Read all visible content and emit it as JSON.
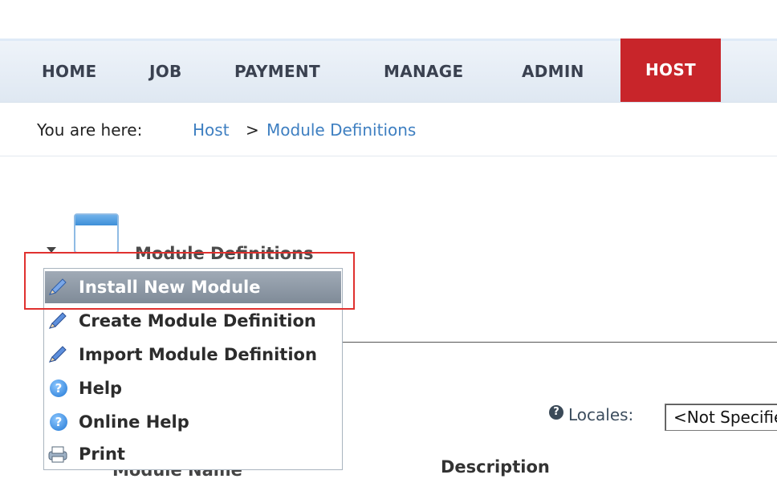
{
  "nav": {
    "items": [
      {
        "label": "HOME"
      },
      {
        "label": "JOB"
      },
      {
        "label": "PAYMENT"
      },
      {
        "label": "MANAGE"
      },
      {
        "label": "ADMIN"
      },
      {
        "label": "HOST"
      }
    ],
    "active": "HOST",
    "active_color": "#c8252a"
  },
  "breadcrumb": {
    "label": "You are here:",
    "items": [
      "Host",
      "Module Definitions"
    ],
    "separator": ">"
  },
  "module": {
    "title": "Module Definitions",
    "icon": "window-icon"
  },
  "menu": {
    "items": [
      {
        "label": "Install New Module",
        "icon": "pencil-icon",
        "highlighted": true
      },
      {
        "label": "Create Module Definition",
        "icon": "pencil-icon"
      },
      {
        "label": "Import Module Definition",
        "icon": "pencil-icon"
      },
      {
        "label": "Help",
        "icon": "help-icon"
      },
      {
        "label": "Online Help",
        "icon": "help-icon"
      },
      {
        "label": "Print",
        "icon": "print-icon"
      }
    ]
  },
  "locales": {
    "help_icon": "?",
    "label": "Locales:",
    "selected": "<Not Specified>"
  },
  "table": {
    "columns": [
      "Module Name",
      "Description"
    ]
  }
}
